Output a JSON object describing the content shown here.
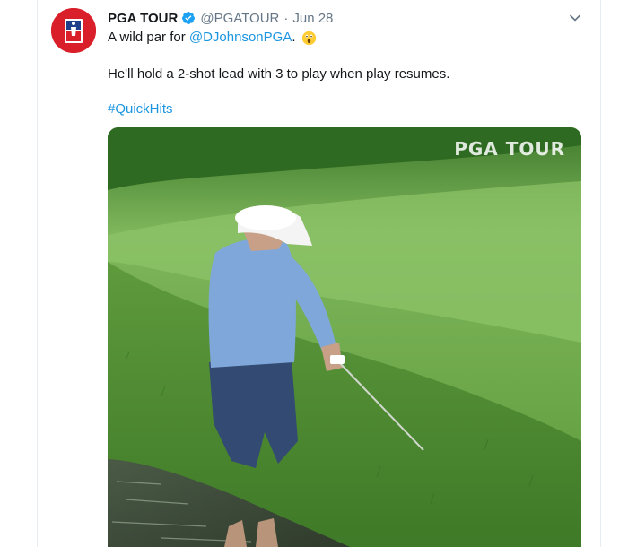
{
  "tweet": {
    "author_name": "PGA TOUR",
    "handle": "@PGATOUR",
    "separator": "·",
    "date": "Jun 28",
    "text_prefix": "A wild par for ",
    "mention": "@DJohnsonPGA",
    "text_suffix": ".",
    "line2": "He'll hold a 2-shot lead with 3 to play when play resumes.",
    "hashtag": "#QuickHits"
  },
  "media": {
    "watermark": "PGA TOUR"
  },
  "icons": {
    "verified": "verified-badge-icon",
    "caret": "chevron-down-icon",
    "emoji": "astonished-face-icon"
  },
  "colors": {
    "link": "#1b95e0",
    "verified": "#1da1f2",
    "avatar_bg": "#d9202a",
    "secondary_text": "#657786"
  }
}
